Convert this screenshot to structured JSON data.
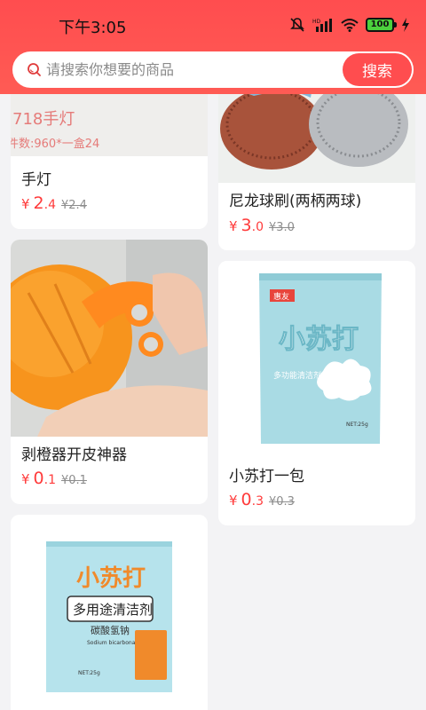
{
  "status": {
    "time": "下午3:05",
    "battery": "100",
    "icons": [
      "mute-icon",
      "hd-icon",
      "signal-icon",
      "wifi-icon",
      "battery-icon",
      "charging-icon"
    ]
  },
  "search": {
    "placeholder": "请搜索你想要的商品",
    "button_label": "搜索"
  },
  "products": [
    {
      "title": "手灯",
      "yen": "¥",
      "price_int": "2",
      "price_dec": ".4",
      "orig": "¥2.4",
      "image_text": {
        "line1": "718手灯",
        "line2": "件数:960*一盒24"
      }
    },
    {
      "title": "尼龙球刷(两柄两球)",
      "yen": "¥",
      "price_int": "3",
      "price_dec": ".0",
      "orig": "¥3.0"
    },
    {
      "title": "剥橙器开皮神器",
      "yen": "¥",
      "price_int": "0",
      "price_dec": ".1",
      "orig": "¥0.1"
    },
    {
      "title": "小苏打一包",
      "yen": "¥",
      "price_int": "0",
      "price_dec": ".3",
      "orig": "¥0.3",
      "image_text": {
        "brand": "惠友",
        "name": "小苏打",
        "desc": "多功能清洁剂",
        "net": "NET:25g"
      }
    },
    {
      "title": "",
      "yen": "",
      "price_int": "",
      "price_dec": "",
      "orig": "",
      "image_text": {
        "name": "小苏打",
        "badge": "多用途清洁剂",
        "sub": "碳酸氢钠",
        "en": "Sodium bicarbonate",
        "net": "NET:25g"
      }
    }
  ],
  "colors": {
    "accent": "#ff4d4f",
    "price": "#ff3b3b",
    "background": "#f3f3f5"
  }
}
